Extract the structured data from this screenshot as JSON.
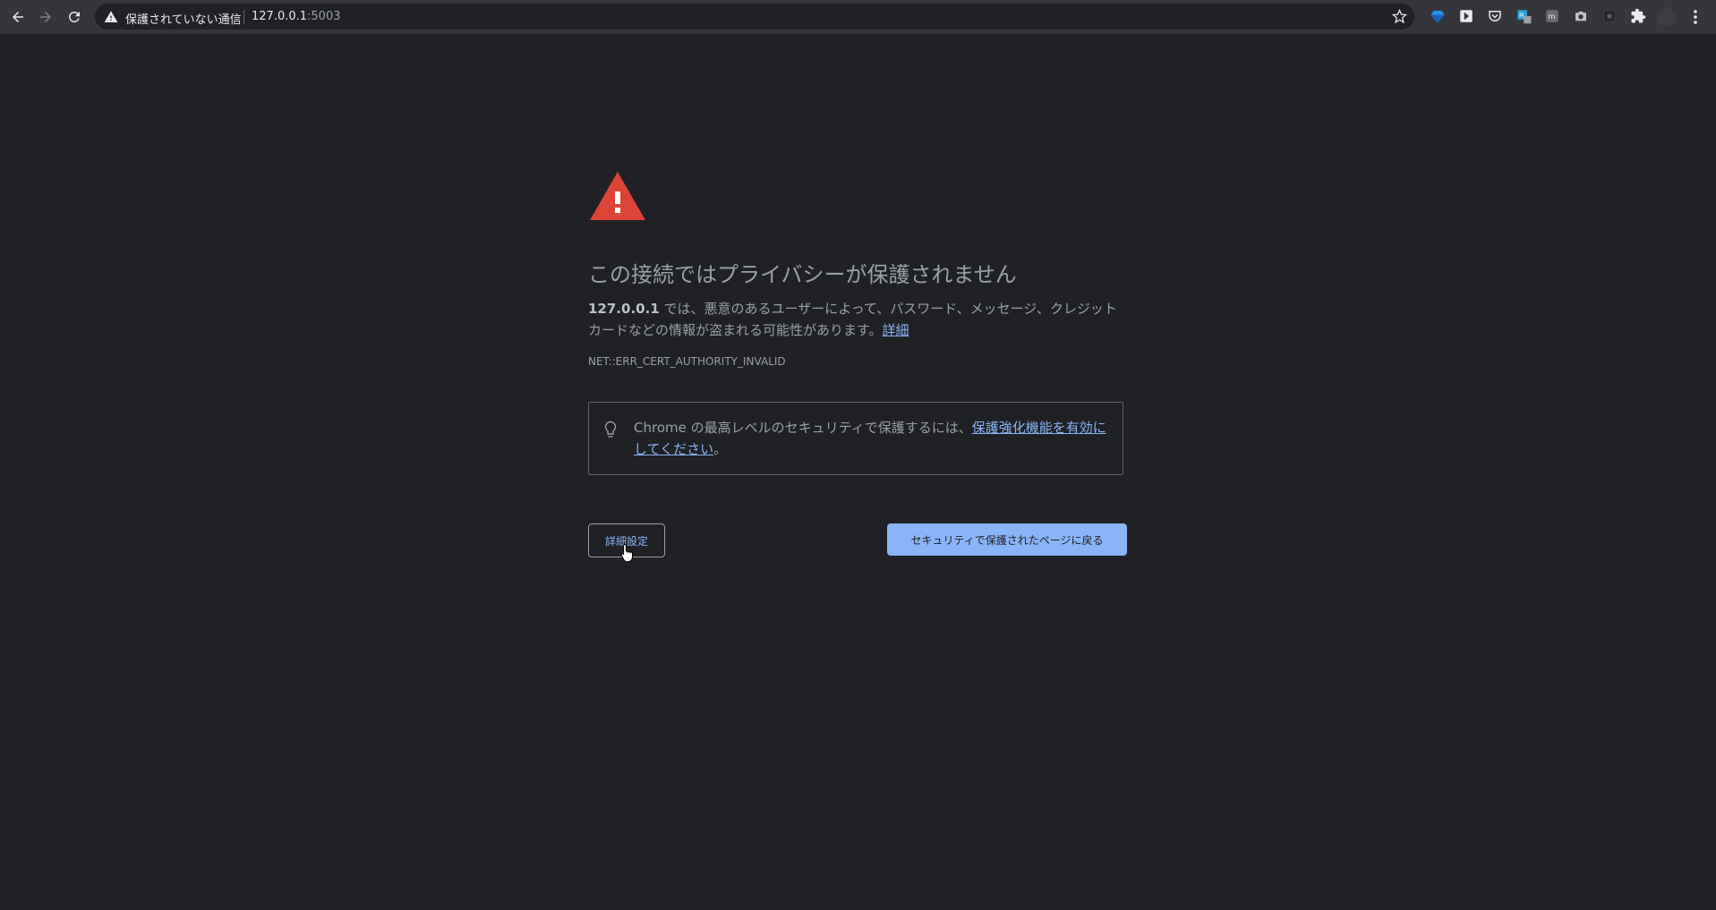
{
  "browser": {
    "security_status": "保護されていない通信",
    "url_host": "127.0.0.1",
    "url_port": ":5003",
    "extensions": [
      "gem-icon",
      "forward-box-icon",
      "pocket-icon",
      "pi-extension-icon",
      "m-extension-icon",
      "camera-icon",
      "dark-extension-icon",
      "puzzle-icon"
    ]
  },
  "interstitial": {
    "heading": "この接続ではプライバシーが保護されません",
    "explanation_host": "127.0.0.1",
    "explanation_text": " では、悪意のあるユーザーによって、パスワード、メッセージ、クレジット カードなどの情報が盗まれる可能性があります。",
    "details_link": "詳細",
    "error_code": "NET::ERR_CERT_AUTHORITY_INVALID",
    "enhanced_text": "Chrome の最高レベルのセキュリティで保護するには、",
    "enhanced_link": "保護強化機能を有効にしてください",
    "enhanced_suffix": "。",
    "advanced_button": "詳細設定",
    "back_button": "セキュリティで保護されたページに戻る"
  },
  "colors": {
    "background": "#202124",
    "accent": "#8ab4f8",
    "warning_red": "#db4437"
  }
}
